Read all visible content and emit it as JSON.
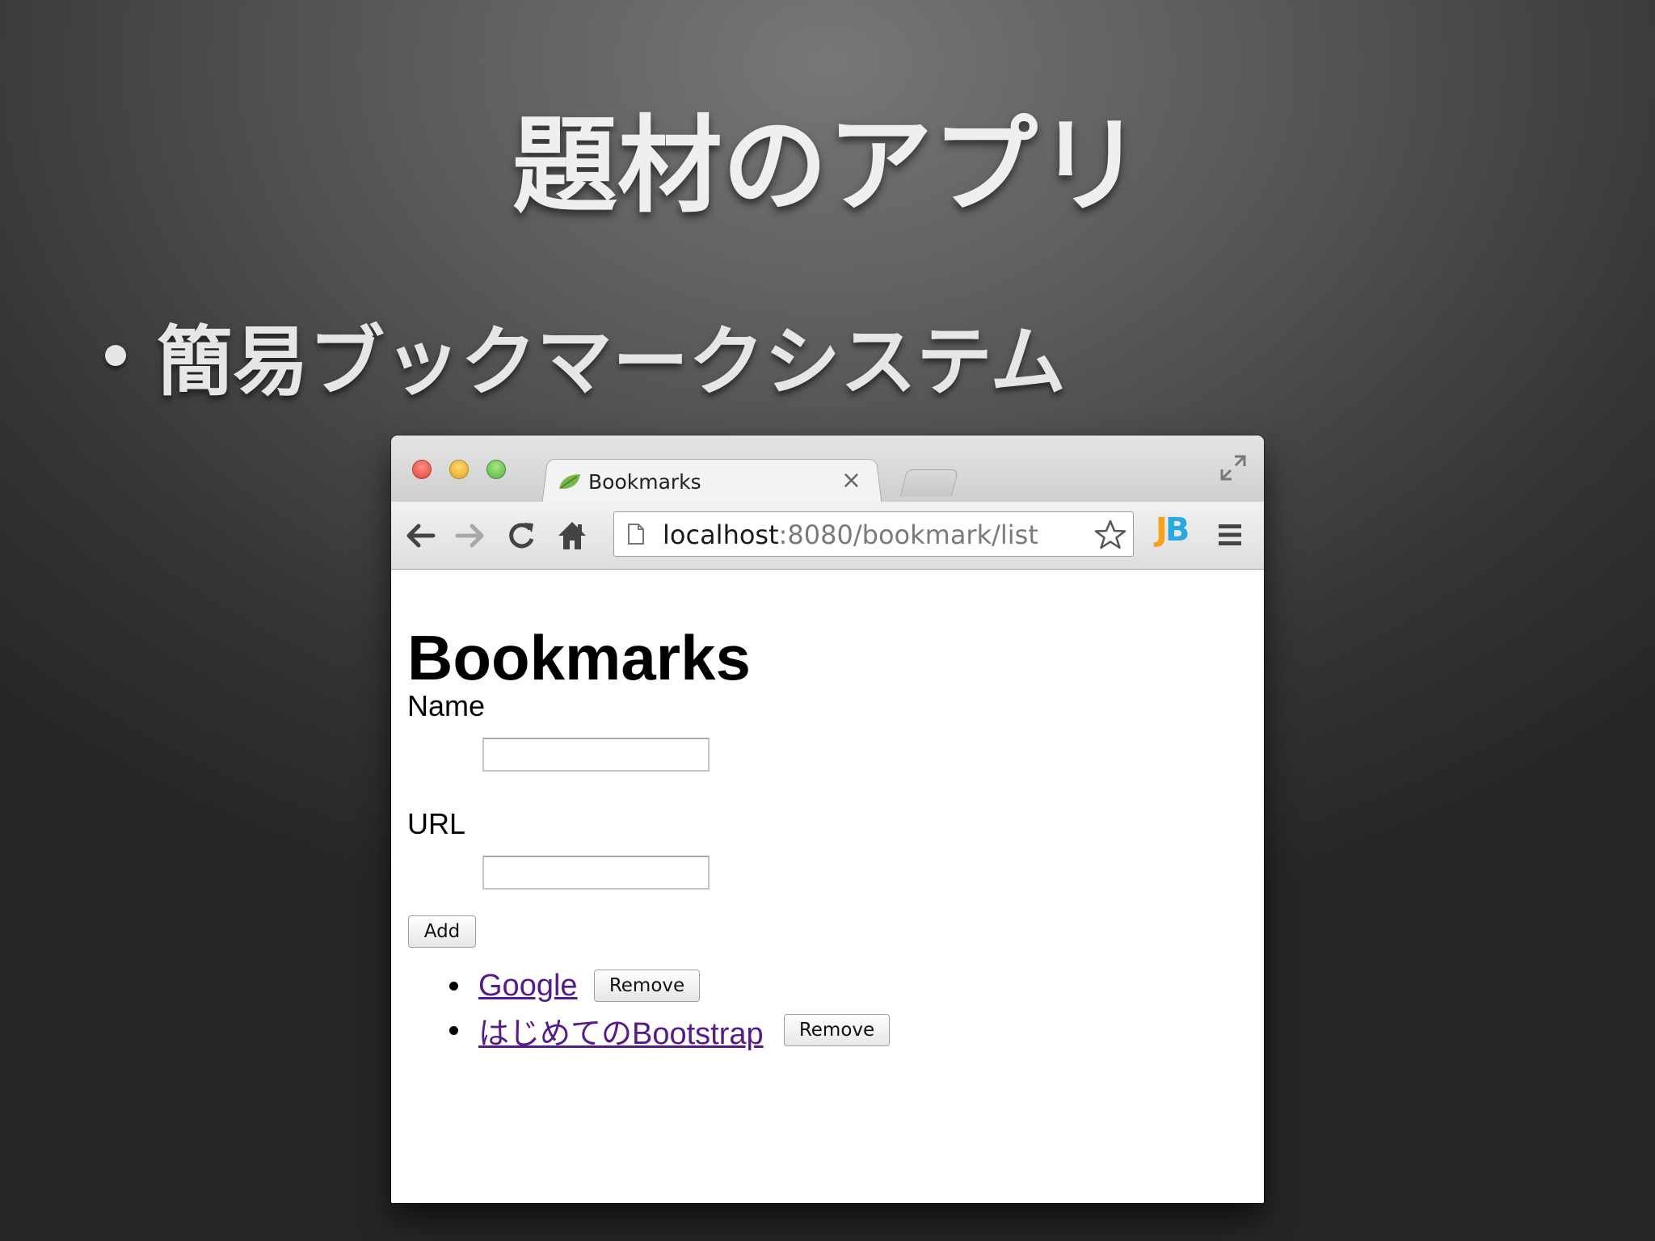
{
  "slide": {
    "title": "題材のアプリ",
    "bullet": "簡易ブックマークシステム"
  },
  "browser": {
    "tab_title": "Bookmarks",
    "tab_close": "×",
    "address_host": "localhost",
    "address_rest": ":8080/bookmark/list",
    "extension": {
      "j": "J",
      "b": "B"
    },
    "icons": [
      "back-arrow-icon",
      "forward-arrow-icon",
      "reload-icon",
      "home-icon",
      "page-icon",
      "star-icon",
      "menu-icon",
      "fullscreen-icon"
    ]
  },
  "page": {
    "heading": "Bookmarks",
    "name_label": "Name",
    "name_value": "",
    "url_label": "URL",
    "url_value": "",
    "add_button": "Add",
    "bookmarks": [
      {
        "name": "Google",
        "remove_label": "Remove"
      },
      {
        "name": "はじめてのBootstrap",
        "remove_label": "Remove"
      }
    ]
  },
  "colors": {
    "visited_link": "#551a8b",
    "jb_j": "#f7a21b",
    "jb_b": "#29a9e0"
  }
}
